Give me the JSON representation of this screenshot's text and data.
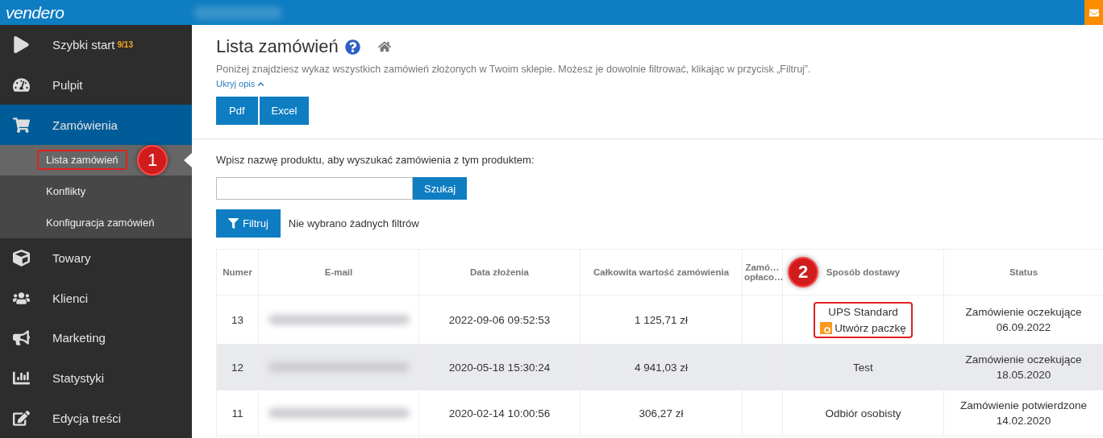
{
  "topbar": {
    "logo": "vendero"
  },
  "sidebar": {
    "items": [
      {
        "label": "Szybki start",
        "badge": "9/13",
        "selected": false
      },
      {
        "label": "Pulpit",
        "selected": false
      },
      {
        "label": "Zamówienia",
        "selected": true,
        "expanded": true,
        "children": [
          {
            "label": "Lista zamówień",
            "selected": true,
            "callout": "1"
          },
          {
            "label": "Konflikty",
            "selected": false
          },
          {
            "label": "Konfiguracja zamówień",
            "selected": false
          }
        ]
      },
      {
        "label": "Towary",
        "selected": false
      },
      {
        "label": "Klienci",
        "selected": false
      },
      {
        "label": "Marketing",
        "selected": false
      },
      {
        "label": "Statystyki",
        "selected": false
      },
      {
        "label": "Edycja treści",
        "selected": false
      }
    ]
  },
  "page": {
    "title": "Lista zamówień",
    "description": "Poniżej znajdziesz wykaz wszystkich zamówień złożonych w Twoim sklepie. Możesz je dowolnie filtrować, klikając w przycisk „Filtruj”.",
    "toggle_link": "Ukryj opis",
    "export_buttons": [
      "Pdf",
      "Excel"
    ]
  },
  "search": {
    "label": "Wpisz nazwę produktu, aby wyszukać zamówienia z tym produktem:",
    "button": "Szukaj"
  },
  "filter": {
    "button": "Filtruj",
    "status": "Nie wybrano żadnych filtrów"
  },
  "table": {
    "columns": [
      {
        "label": "Numer"
      },
      {
        "label": "E-mail"
      },
      {
        "label": "Data złożenia"
      },
      {
        "label": "Całkowita wartość zamówienia"
      },
      {
        "label": "Zamó… opłaco…"
      },
      {
        "label": "Sposób dostawy",
        "callout": "2"
      },
      {
        "label": "Status"
      }
    ],
    "rows": [
      {
        "number": "13",
        "date": "2022-09-06 09:52:53",
        "total": "1 125,71 zł",
        "delivery": "UPS Standard",
        "action": "Utwórz paczkę",
        "highlighted": true,
        "status": "Zamówienie oczekujące",
        "status_date": "06.09.2022"
      },
      {
        "number": "12",
        "date": "2020-05-18 15:30:24",
        "total": "4 941,03 zł",
        "delivery": "Test",
        "highlighted": false,
        "status": "Zamówienie oczekujące",
        "status_date": "18.05.2020"
      },
      {
        "number": "11",
        "date": "2020-02-14 10:00:56",
        "total": "306,27 zł",
        "delivery": "Odbiór osobisty",
        "highlighted": false,
        "status": "Zamówienie potwierdzone",
        "status_date": "14.02.2020"
      }
    ]
  }
}
